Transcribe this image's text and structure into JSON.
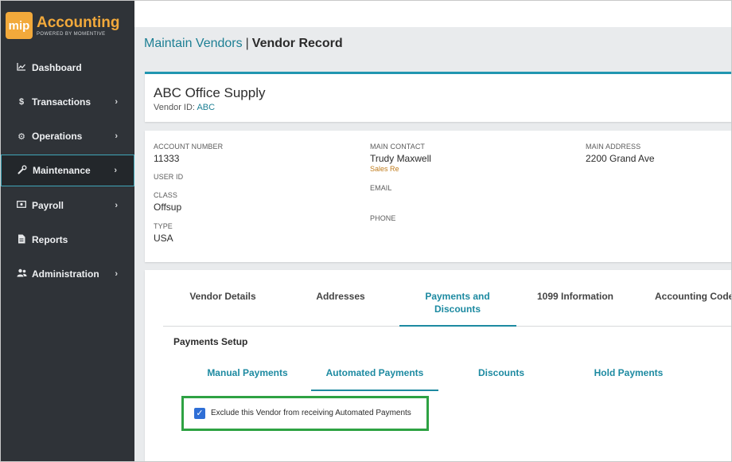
{
  "brand": {
    "badge": "mip",
    "title": "Accounting",
    "subtitle": "POWERED BY MOMENTIVE",
    "accent": "#f2a93b"
  },
  "sidebar": {
    "items": [
      {
        "label": "Dashboard",
        "icon": "chart-line-icon",
        "has_chevron": false
      },
      {
        "label": "Transactions",
        "icon": "dollar-icon",
        "has_chevron": true
      },
      {
        "label": "Operations",
        "icon": "cogs-icon",
        "has_chevron": true
      },
      {
        "label": "Maintenance",
        "icon": "wrench-icon",
        "has_chevron": true,
        "active": true
      },
      {
        "label": "Payroll",
        "icon": "money-bill-icon",
        "has_chevron": true
      },
      {
        "label": "Reports",
        "icon": "file-icon",
        "has_chevron": false
      },
      {
        "label": "Administration",
        "icon": "users-icon",
        "has_chevron": true
      }
    ]
  },
  "breadcrumb": {
    "parent": "Maintain Vendors",
    "separator": "|",
    "current": "Vendor Record"
  },
  "vendor": {
    "name": "ABC Office Supply",
    "id_label": "Vendor ID:",
    "id_value": "ABC"
  },
  "info": {
    "account_number_label": "ACCOUNT NUMBER",
    "account_number": "11333",
    "user_id_label": "USER ID",
    "class_label": "CLASS",
    "class": "Offsup",
    "type_label": "TYPE",
    "type": "USA",
    "main_contact_label": "MAIN CONTACT",
    "main_contact": "Trudy Maxwell",
    "main_contact_role": "Sales Re",
    "email_label": "EMAIL",
    "phone_label": "PHONE",
    "main_address_label": "MAIN ADDRESS",
    "main_address": "2200 Grand Ave"
  },
  "tabs": [
    {
      "label": "Vendor Details"
    },
    {
      "label": "Addresses"
    },
    {
      "label_line1": "Payments and",
      "label_line2": "Discounts",
      "active": true
    },
    {
      "label": "1099 Information"
    },
    {
      "label": "Accounting Codes"
    }
  ],
  "payments": {
    "section_title": "Payments Setup",
    "subtabs": [
      {
        "label": "Manual Payments"
      },
      {
        "label": "Automated Payments",
        "active": true
      },
      {
        "label": "Discounts"
      },
      {
        "label": "Hold Payments"
      }
    ],
    "exclude_checkbox_label": "Exclude this Vendor from receiving Automated Payments",
    "exclude_checked": true
  }
}
